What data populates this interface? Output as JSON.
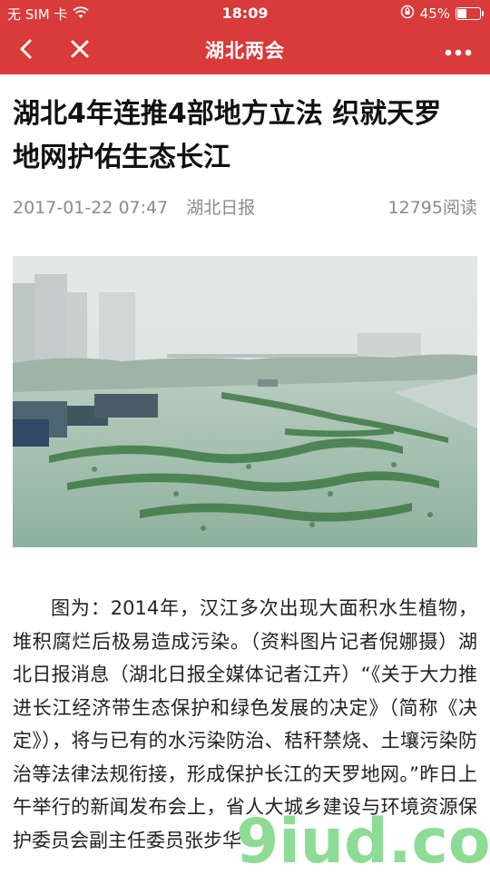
{
  "status_bar": {
    "carrier": "无 SIM 卡",
    "time": "18:09",
    "battery_percent": "45%",
    "battery_level": 0.45,
    "icons": [
      "wifi-icon",
      "rotation-lock-icon",
      "battery-icon"
    ]
  },
  "nav": {
    "title": "湖北两会",
    "icons": [
      "back-arrow-icon",
      "close-icon",
      "more-icon"
    ]
  },
  "article": {
    "title": "湖北4年连推4部地方立法 织就天罗地网护佑生态长江",
    "date": "2017-01-22 07:47",
    "source": "湖北日报",
    "reads": "12795阅读",
    "body": "图为：2014年，汉江多次出现大面积水生植物，堆积腐烂后极易造成污染。（资料图片记者倪娜摄）湖北日报消息（湖北日报全媒体记者江卉）“《关于大力推进长江经济带生态保护和绿色发展的决定》（简称《决定》），将与已有的水污染防治、秸秆禁烧、土壤污染防治等法律法规衔接，形成保护长江的天罗地网。”昨日上午举行的新闻发布会上，省人大城乡建设与环境资源保护委员会副主任委员张步华"
  },
  "watermark": {
    "text": "9iud.com"
  },
  "colors": {
    "header_red": "#d93a3a",
    "meta_gray": "#8a8a8a",
    "watermark_green": "#2fbf3f"
  }
}
